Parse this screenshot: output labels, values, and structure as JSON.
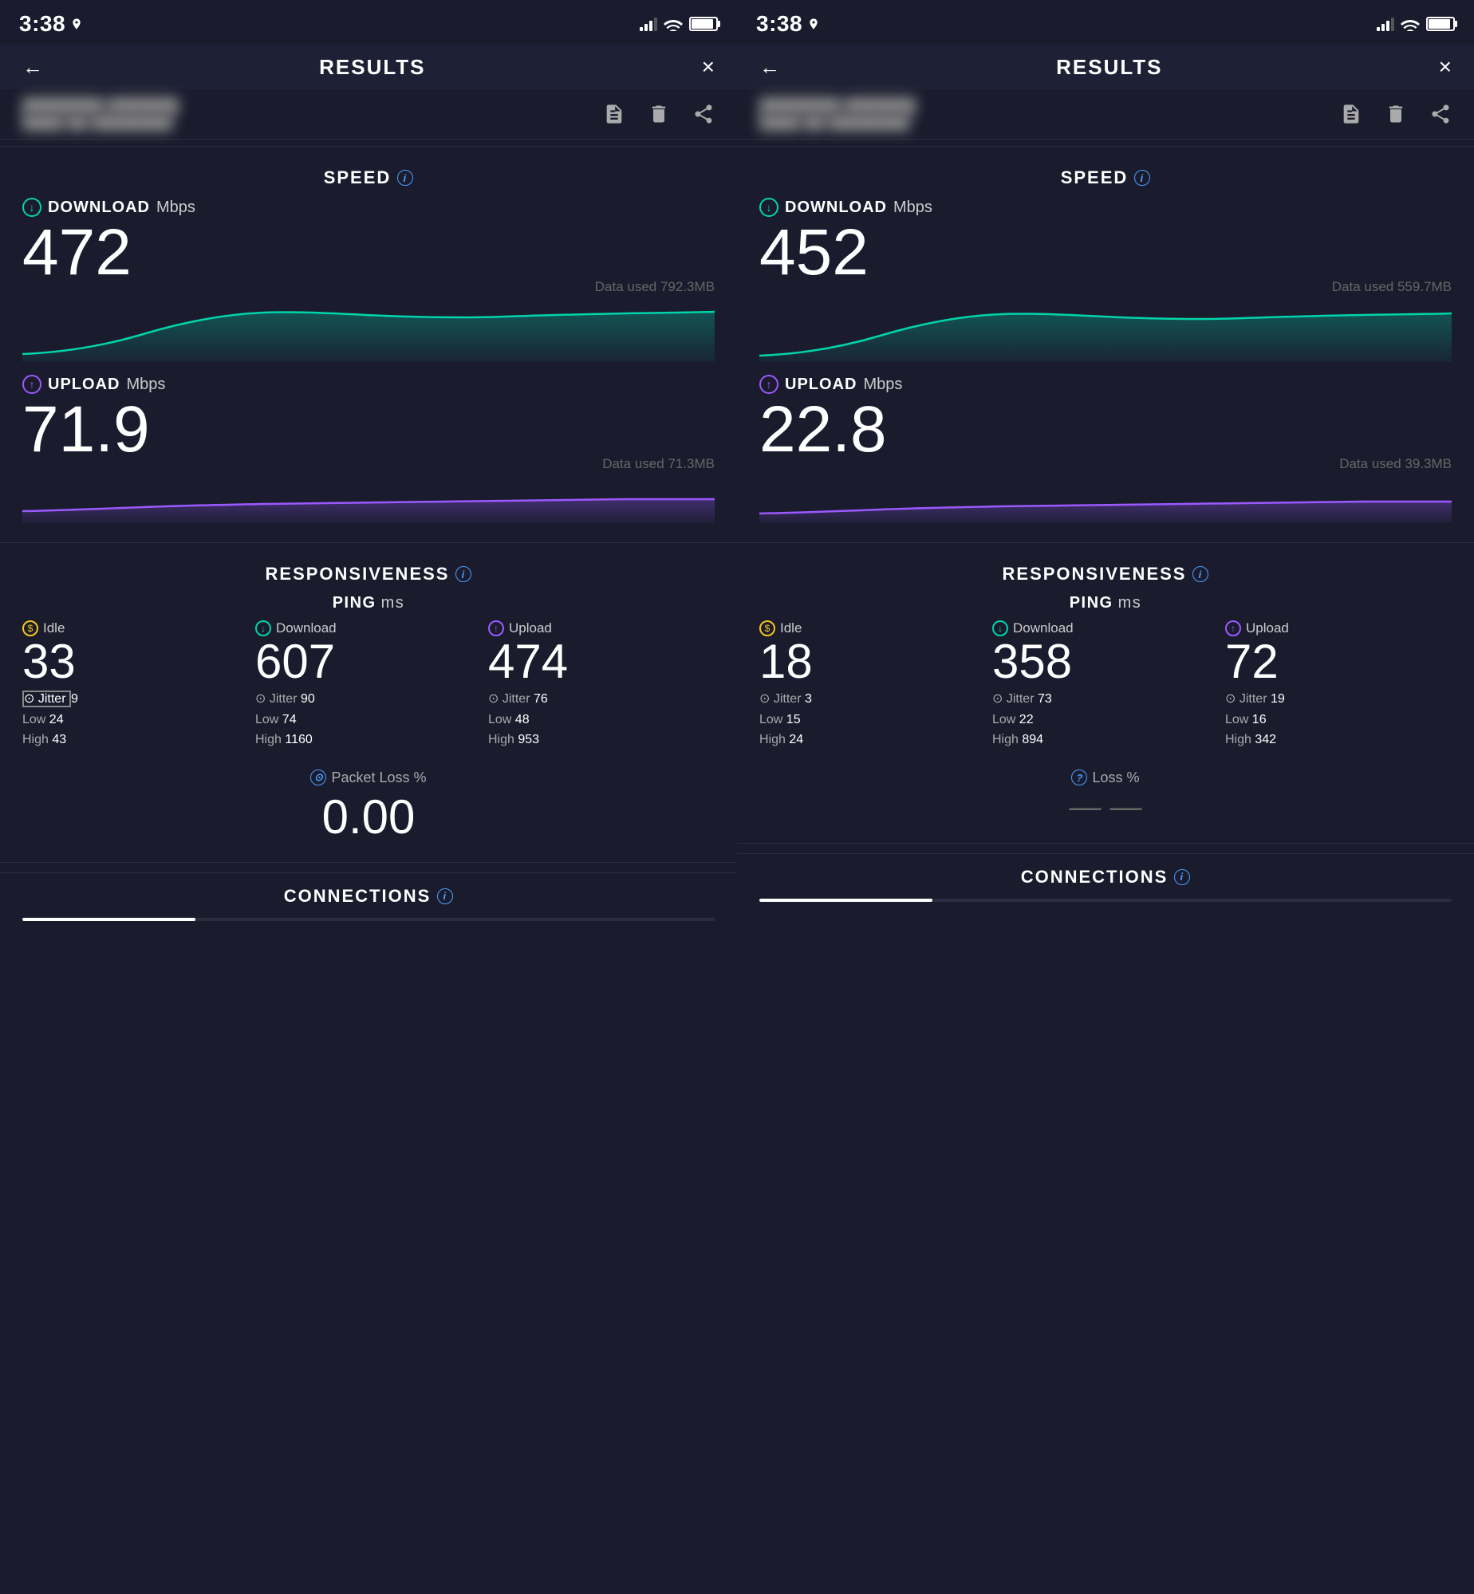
{
  "panels": [
    {
      "id": "left",
      "status_bar": {
        "time": "3:38",
        "location_icon": true
      },
      "header": {
        "title": "RESULTS",
        "back_label": "←",
        "close_label": "×"
      },
      "toolbar": {
        "meta_line1": "████████ ████████",
        "meta_line2": "████ ██ ████████",
        "icons": [
          "notes",
          "delete",
          "share"
        ]
      },
      "speed": {
        "section_title": "SPEED",
        "download": {
          "label": "DOWNLOAD",
          "unit": "Mbps",
          "value": "472",
          "data_used": "Data used 792.3MB"
        },
        "upload": {
          "label": "UPLOAD",
          "unit": "Mbps",
          "value": "71.9",
          "data_used": "Data used 71.3MB"
        }
      },
      "responsiveness": {
        "section_title": "RESPONSIVENESS",
        "ping_label": "PING",
        "ping_unit": "ms",
        "idle": {
          "label": "Idle",
          "value": "33",
          "jitter": "9",
          "low": "24",
          "high": "43"
        },
        "download": {
          "label": "Download",
          "value": "607",
          "jitter": "90",
          "low": "74",
          "high": "1160"
        },
        "upload": {
          "label": "Upload",
          "value": "474",
          "jitter": "76",
          "low": "48",
          "high": "953"
        },
        "packet_loss": {
          "label": "Packet Loss %",
          "value": "0.00"
        }
      },
      "connections": {
        "title": "CONNECTIONS"
      },
      "progress": {
        "fill_percent": 25
      }
    },
    {
      "id": "right",
      "status_bar": {
        "time": "3:38",
        "location_icon": true
      },
      "header": {
        "title": "RESULTS",
        "back_label": "←",
        "close_label": "×"
      },
      "toolbar": {
        "meta_line1": "████████ ████████",
        "meta_line2": "████ ██ ████████",
        "icons": [
          "notes",
          "delete",
          "share"
        ]
      },
      "speed": {
        "section_title": "SPEED",
        "download": {
          "label": "DOWNLOAD",
          "unit": "Mbps",
          "value": "452",
          "data_used": "Data used 559.7MB"
        },
        "upload": {
          "label": "UPLOAD",
          "unit": "Mbps",
          "value": "22.8",
          "data_used": "Data used 39.3MB"
        }
      },
      "responsiveness": {
        "section_title": "RESPONSIVENESS",
        "ping_label": "PING",
        "ping_unit": "ms",
        "idle": {
          "label": "Idle",
          "value": "18",
          "jitter": "3",
          "low": "15",
          "high": "24"
        },
        "download": {
          "label": "Download",
          "value": "358",
          "jitter": "73",
          "low": "22",
          "high": "894"
        },
        "upload": {
          "label": "Upload",
          "value": "72",
          "jitter": "19",
          "low": "16",
          "high": "342"
        },
        "packet_loss": {
          "label": "Loss %",
          "value": "—  —"
        }
      },
      "connections": {
        "title": "CONNECTIONS"
      },
      "progress": {
        "fill_percent": 25
      }
    }
  ],
  "colors": {
    "bg": "#1a1c2e",
    "card_bg": "#1e2035",
    "download_color": "#00d4aa",
    "upload_color": "#9b59ff",
    "idle_color": "#f5c518",
    "text_primary": "#ffffff",
    "text_secondary": "#aaaaaa",
    "divider": "#2a2d40"
  }
}
